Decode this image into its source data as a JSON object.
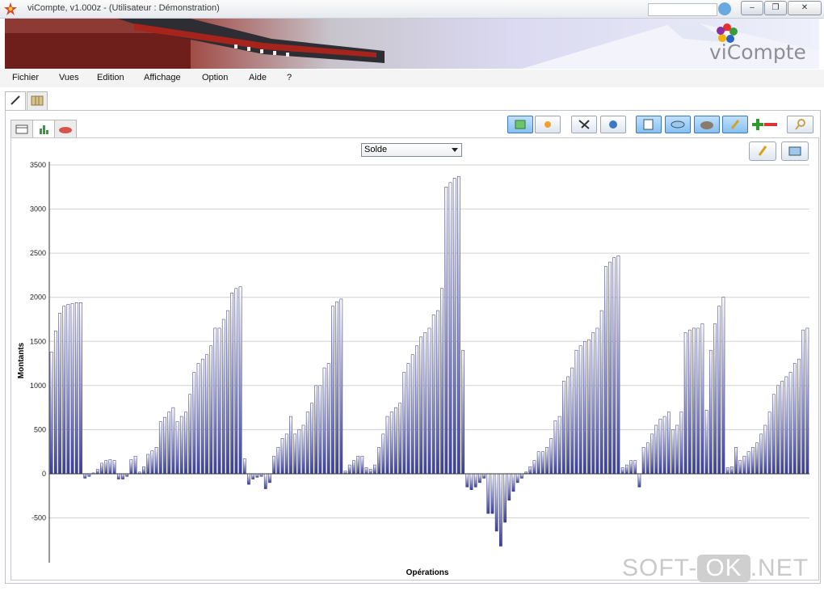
{
  "window": {
    "title": "viCompte, v1.000z - (Utilisateur : Démonstration)",
    "minimize": "–",
    "maximize": "❐",
    "close": "✕"
  },
  "banner": {
    "logo_text": "viCompte"
  },
  "menu": [
    "Fichier",
    "Vues",
    "Edition",
    "Affichage",
    "Option",
    "Aide",
    "?"
  ],
  "chart_controls": {
    "select_value": "Solde"
  },
  "watermark": {
    "left": "SOFT-",
    "ok": "OK",
    "right": ".NET"
  },
  "colors": {
    "bar_fill": "#3a3f9b",
    "bar_light": "#ffffff",
    "grid": "#d0d0d0"
  },
  "chart_data": {
    "type": "bar",
    "title": "",
    "xlabel": "Opérations",
    "ylabel": "Montants",
    "ylim": [
      -1000,
      3500
    ],
    "yticks": [
      3500,
      3000,
      2500,
      2000,
      1500,
      1000,
      500,
      0,
      -500
    ],
    "grid": true,
    "legend": "none",
    "values": [
      1380,
      1620,
      1820,
      1900,
      1920,
      1930,
      1940,
      1940,
      -50,
      -30,
      10,
      50,
      120,
      150,
      160,
      150,
      -60,
      -60,
      -30,
      160,
      200,
      20,
      80,
      220,
      260,
      300,
      590,
      640,
      700,
      750,
      590,
      650,
      700,
      900,
      1150,
      1250,
      1300,
      1350,
      1450,
      1650,
      1650,
      1750,
      1850,
      2050,
      2100,
      2120,
      170,
      -120,
      -60,
      -40,
      -30,
      -170,
      -100,
      200,
      300,
      400,
      450,
      650,
      450,
      500,
      550,
      700,
      800,
      1000,
      1000,
      1200,
      1250,
      1900,
      1950,
      1980,
      30,
      100,
      150,
      200,
      200,
      70,
      50,
      100,
      300,
      450,
      650,
      700,
      750,
      800,
      1150,
      1250,
      1350,
      1450,
      1550,
      1600,
      1650,
      1800,
      1850,
      2100,
      3250,
      3300,
      3350,
      3370,
      1400,
      -150,
      -180,
      -150,
      -100,
      -50,
      -450,
      -450,
      -650,
      -820,
      -550,
      -300,
      -200,
      -100,
      -50,
      20,
      80,
      150,
      250,
      250,
      300,
      400,
      600,
      650,
      1050,
      1100,
      1200,
      1400,
      1450,
      1500,
      1520,
      1600,
      1650,
      1850,
      2350,
      2400,
      2450,
      2470,
      70,
      100,
      150,
      150,
      -150,
      300,
      350,
      450,
      550,
      620,
      650,
      700,
      500,
      550,
      700,
      1600,
      1630,
      1650,
      1650,
      1700,
      720,
      1400,
      1700,
      1900,
      2000,
      70,
      80,
      300,
      150,
      200,
      250,
      300,
      350,
      450,
      550,
      700,
      900,
      1000,
      1050,
      1100,
      1150,
      1250,
      1300,
      1630,
      1650
    ]
  }
}
